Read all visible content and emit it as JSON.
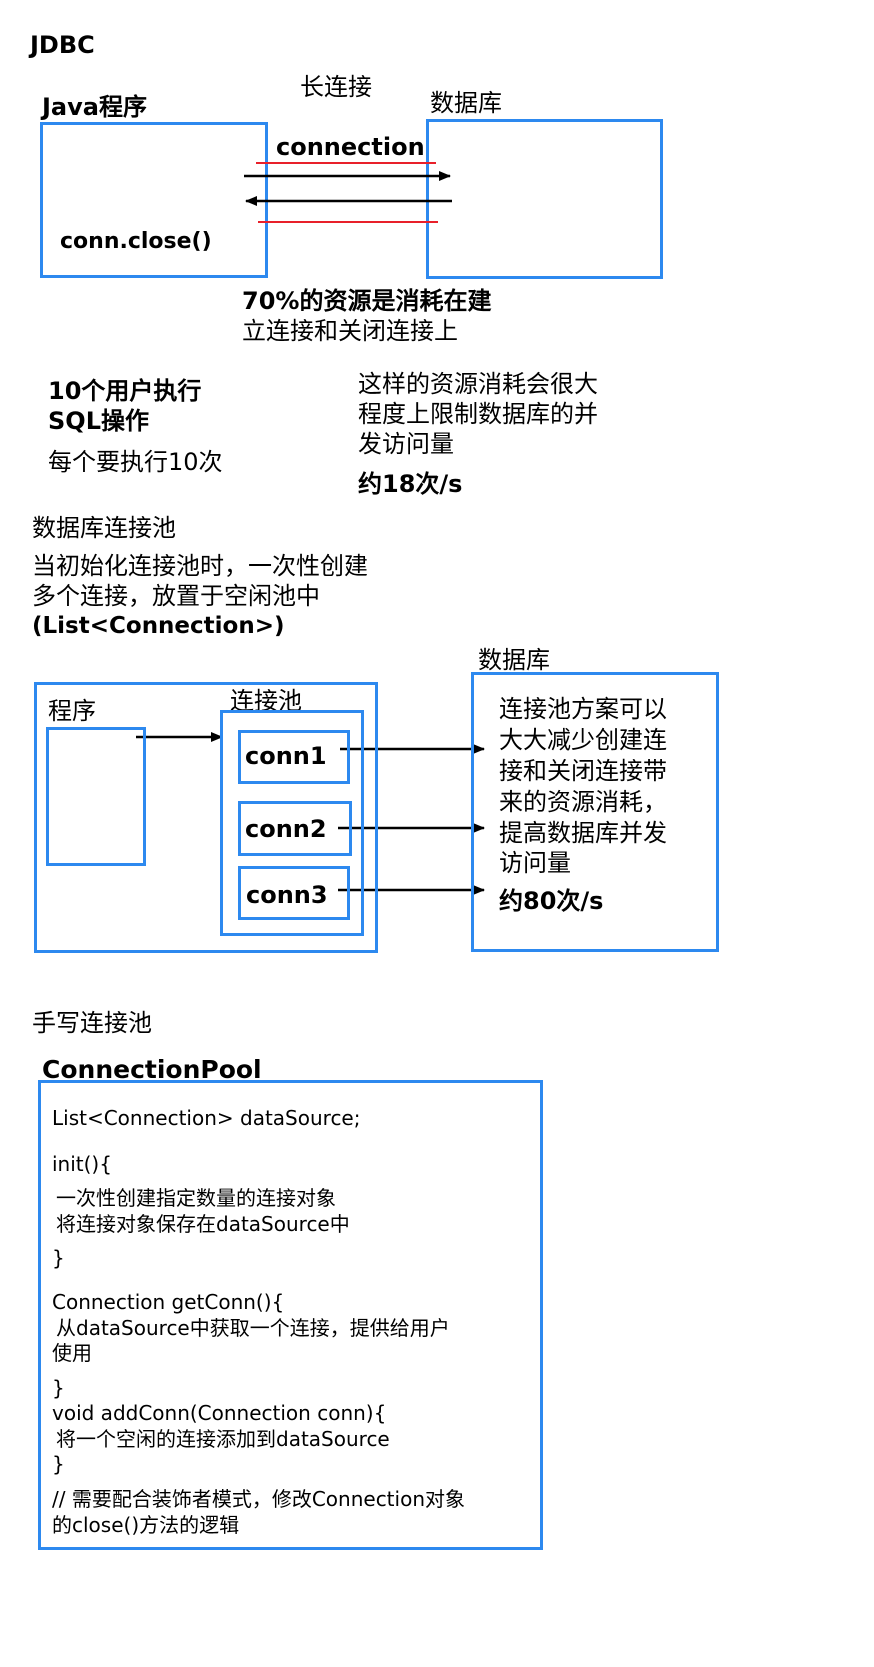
{
  "section1": {
    "title": "JDBC",
    "long_connection_label": "长连接",
    "java_program_label": "Java程序",
    "database_label": "数据库",
    "connection_label": "connection",
    "close_call": "conn.close()",
    "resource_note_line1": "70%的资源是消耗在建",
    "resource_note_line2": "立连接和关闭连接上",
    "users_line1": "10个用户执行",
    "users_line2": "SQL操作",
    "each_runs": "每个要执行10次",
    "limit_line1": "这样的资源消耗会很大",
    "limit_line2": "程度上限制数据库的并",
    "limit_line3": "发访问量",
    "rate": "约18次/s"
  },
  "section2": {
    "title": "数据库连接池",
    "desc_line1": "当初始化连接池时，一次性创建",
    "desc_line2": "多个连接，放置于空闲池中",
    "desc_line3": "(List<Connection>)",
    "database_label": "数据库",
    "program_label": "程序",
    "pool_label": "连接池",
    "conns": [
      "conn1",
      "conn2",
      "conn3"
    ],
    "benefit_lines": [
      "连接池方案可以",
      "大大减少创建连",
      "接和关闭连接带",
      "来的资源消耗，",
      "提高数据库并发",
      "访问量"
    ],
    "rate": "约80次/s"
  },
  "section3": {
    "title": "手写连接池",
    "class_name": "ConnectionPool",
    "code_lines": [
      "List<Connection> dataSource;",
      "init(){",
      "  一次性创建指定数量的连接对象",
      "  将连接对象保存在dataSource中",
      "}",
      "Connection getConn(){",
      "  从dataSource中获取一个连接，提供给用户",
      "使用",
      "}",
      "void addConn(Connection conn){",
      "  将一个空闲的连接添加到dataSource",
      "}",
      "// 需要配合装饰者模式，修改Connection对象",
      "的close()方法的逻辑"
    ]
  },
  "colors": {
    "box_border": "#2d89ef",
    "red_line": "#e8202a",
    "arrow": "#000000"
  }
}
